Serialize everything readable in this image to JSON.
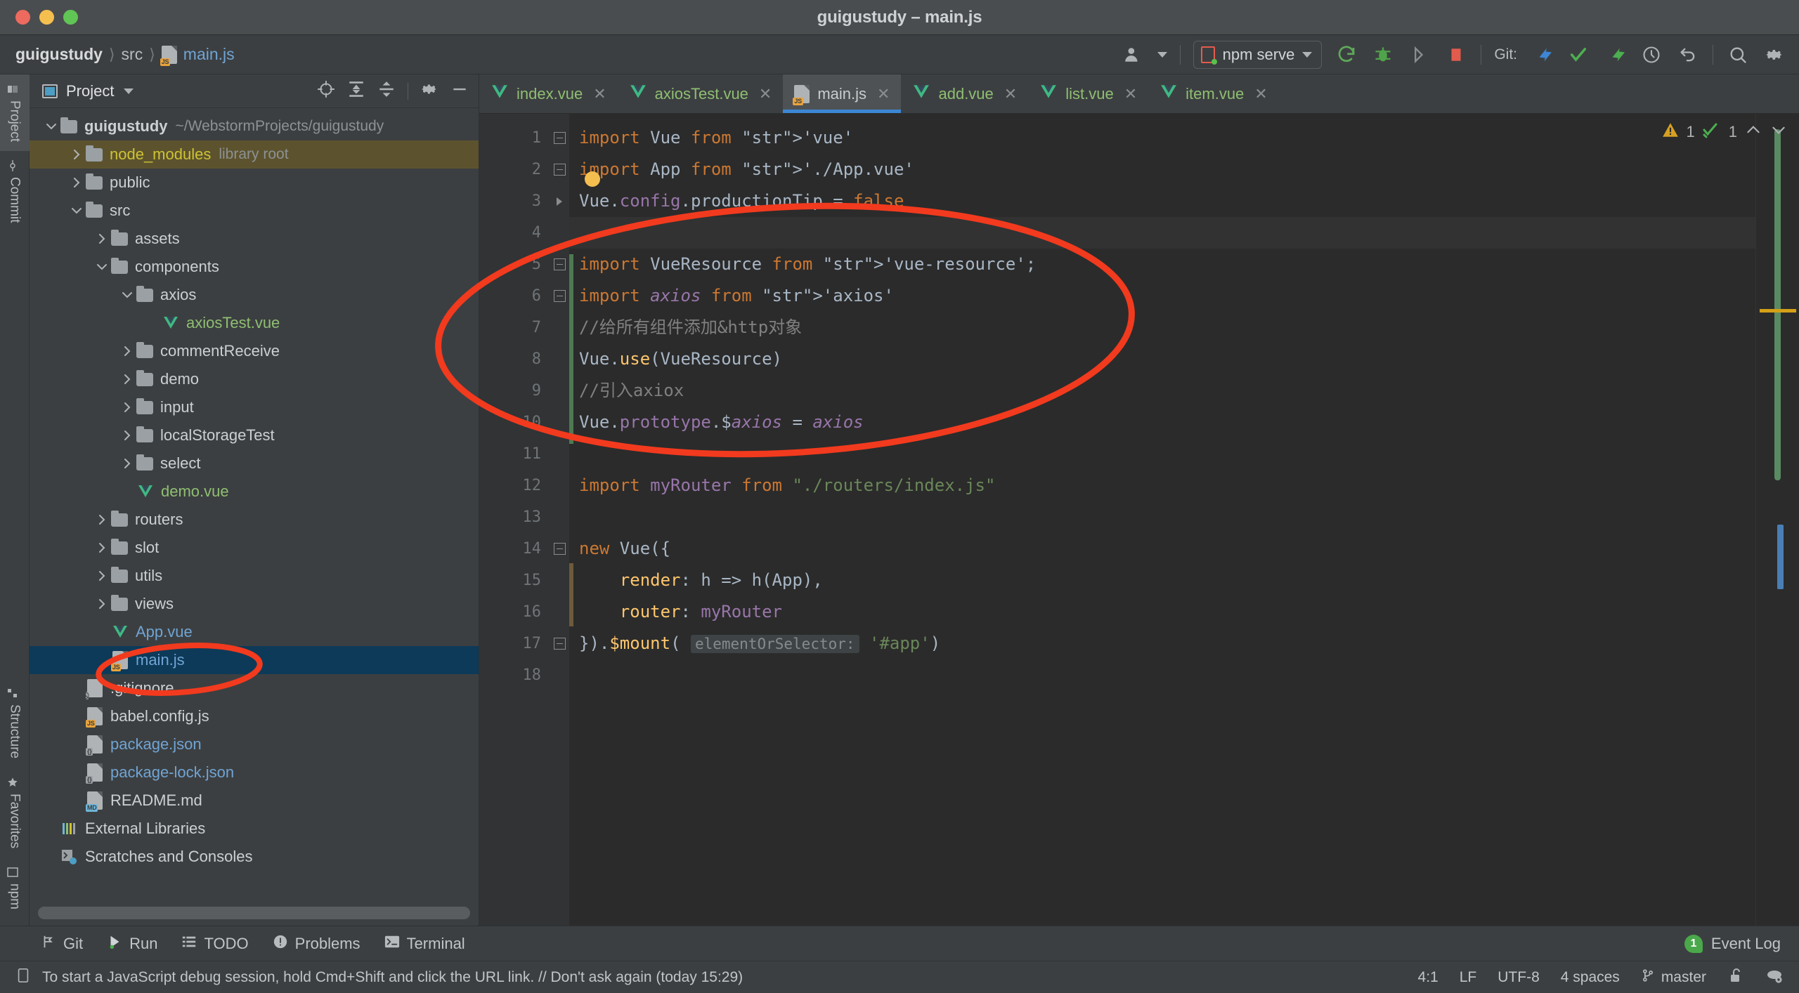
{
  "window": {
    "title": "guigustudy – main.js",
    "traffic_lights": [
      "close-red",
      "minimize-yellow",
      "zoom-green"
    ]
  },
  "breadcrumb": {
    "items": [
      {
        "label": "guigustudy",
        "kind": "project"
      },
      {
        "label": "src",
        "kind": "folder"
      },
      {
        "label": "main.js",
        "kind": "js-file"
      }
    ],
    "separator": "›"
  },
  "toolbar": {
    "account_label": "",
    "run_config": "npm serve",
    "git_label": "Git:",
    "icons": [
      "user-avatar-icon",
      "chevron-down-icon",
      "run-config-icon",
      "run-icon",
      "debug-icon",
      "coverage-icon",
      "stop-icon",
      "git-update-icon",
      "git-commit-icon",
      "git-push-icon",
      "history-icon",
      "rollback-icon",
      "search-everywhere-icon",
      "settings-gear-icon"
    ]
  },
  "left_rail": {
    "top": [
      {
        "label": "Project",
        "icon": "project-icon",
        "active": true
      },
      {
        "label": "Commit",
        "icon": "commit-icon",
        "active": false
      }
    ],
    "bottom": [
      {
        "label": "Structure",
        "icon": "structure-icon",
        "active": false
      },
      {
        "label": "Favorites",
        "icon": "star-icon",
        "active": false
      },
      {
        "label": "npm",
        "icon": "npm-icon",
        "active": false
      }
    ]
  },
  "project_panel": {
    "title": "Project",
    "toolbar_icons": [
      "locate-icon",
      "expand-all-icon",
      "collapse-all-icon",
      "settings-gear-icon",
      "hide-icon"
    ],
    "tree": [
      {
        "indent": 0,
        "arrow": "down",
        "icon": "folder",
        "label": "guigustudy",
        "sub": "~/WebstormProjects/guigustudy",
        "bold": true
      },
      {
        "indent": 1,
        "arrow": "right",
        "icon": "folder",
        "label": "node_modules",
        "sub": "library root",
        "style": "yellowish",
        "highlight": true
      },
      {
        "indent": 1,
        "arrow": "right",
        "icon": "folder",
        "label": "public"
      },
      {
        "indent": 1,
        "arrow": "down",
        "icon": "folder",
        "label": "src"
      },
      {
        "indent": 2,
        "arrow": "right",
        "icon": "folder",
        "label": "assets"
      },
      {
        "indent": 2,
        "arrow": "down",
        "icon": "folder",
        "label": "components"
      },
      {
        "indent": 3,
        "arrow": "down",
        "icon": "folder",
        "label": "axios"
      },
      {
        "indent": 4,
        "arrow": "none",
        "icon": "vue",
        "label": "axiosTest.vue",
        "style": "vue"
      },
      {
        "indent": 3,
        "arrow": "right",
        "icon": "folder",
        "label": "commentReceive"
      },
      {
        "indent": 3,
        "arrow": "right",
        "icon": "folder",
        "label": "demo"
      },
      {
        "indent": 3,
        "arrow": "right",
        "icon": "folder",
        "label": "input"
      },
      {
        "indent": 3,
        "arrow": "right",
        "icon": "folder",
        "label": "localStorageTest"
      },
      {
        "indent": 3,
        "arrow": "right",
        "icon": "folder",
        "label": "select"
      },
      {
        "indent": 3,
        "arrow": "none",
        "icon": "vue",
        "label": "demo.vue",
        "style": "vue"
      },
      {
        "indent": 2,
        "arrow": "right",
        "icon": "folder",
        "label": "routers"
      },
      {
        "indent": 2,
        "arrow": "right",
        "icon": "folder",
        "label": "slot"
      },
      {
        "indent": 2,
        "arrow": "right",
        "icon": "folder",
        "label": "utils"
      },
      {
        "indent": 2,
        "arrow": "right",
        "icon": "folder",
        "label": "views"
      },
      {
        "indent": 2,
        "arrow": "none",
        "icon": "vue",
        "label": "App.vue",
        "style": "blue"
      },
      {
        "indent": 2,
        "arrow": "none",
        "icon": "js",
        "label": "main.js",
        "style": "blue",
        "selected": true
      },
      {
        "indent": 1,
        "arrow": "none",
        "icon": "git",
        "label": ".gitignore"
      },
      {
        "indent": 1,
        "arrow": "none",
        "icon": "js",
        "label": "babel.config.js"
      },
      {
        "indent": 1,
        "arrow": "none",
        "icon": "json",
        "label": "package.json",
        "style": "json"
      },
      {
        "indent": 1,
        "arrow": "none",
        "icon": "json",
        "label": "package-lock.json",
        "style": "json"
      },
      {
        "indent": 1,
        "arrow": "none",
        "icon": "md",
        "label": "README.md"
      },
      {
        "indent": 0,
        "arrow": "none",
        "icon": "lib",
        "label": "External Libraries"
      },
      {
        "indent": 0,
        "arrow": "none",
        "icon": "scratch",
        "label": "Scratches and Consoles"
      }
    ]
  },
  "editor": {
    "tabs": [
      {
        "label": "index.vue",
        "icon": "vue-icon",
        "active": false
      },
      {
        "label": "axiosTest.vue",
        "icon": "vue-icon",
        "active": false
      },
      {
        "label": "main.js",
        "icon": "js-icon",
        "active": true
      },
      {
        "label": "add.vue",
        "icon": "vue-icon",
        "active": false
      },
      {
        "label": "list.vue",
        "icon": "vue-icon",
        "active": false
      },
      {
        "label": "item.vue",
        "icon": "vue-icon",
        "active": false
      }
    ],
    "close_glyph": "✕",
    "inspections": {
      "warning_count": "1",
      "ok_count": "1",
      "up_glyph": "⌃",
      "down_glyph": "⌄"
    },
    "line_numbers": [
      "1",
      "2",
      "3",
      "4",
      "5",
      "6",
      "7",
      "8",
      "9",
      "10",
      "11",
      "12",
      "13",
      "14",
      "15",
      "16",
      "17",
      "18"
    ],
    "lines": [
      {
        "n": 1,
        "text": "import Vue from 'vue'"
      },
      {
        "n": 2,
        "text": "import App from './App.vue'"
      },
      {
        "n": 3,
        "text": "Vue.config.productionTip = false"
      },
      {
        "n": 4,
        "text": ""
      },
      {
        "n": 5,
        "text": "import VueResource from 'vue-resource';"
      },
      {
        "n": 6,
        "text": "import axios from 'axios'"
      },
      {
        "n": 7,
        "text": "//给所有组件添加&http对象"
      },
      {
        "n": 8,
        "text": "Vue.use(VueResource)"
      },
      {
        "n": 9,
        "text": "//引入axiox"
      },
      {
        "n": 10,
        "text": "Vue.prototype.$axios = axios"
      },
      {
        "n": 11,
        "text": ""
      },
      {
        "n": 12,
        "text": "import myRouter from \"./routers/index.js\""
      },
      {
        "n": 13,
        "text": ""
      },
      {
        "n": 14,
        "text": "new Vue({"
      },
      {
        "n": 15,
        "text": "    render: h => h(App),"
      },
      {
        "n": 16,
        "text": "    router: myRouter"
      },
      {
        "n": 17,
        "text": "}).$mount( elementOrSelector: '#app')"
      },
      {
        "n": 18,
        "text": ""
      }
    ],
    "param_hint": "elementOrSelector:"
  },
  "bottom_bar": {
    "items": [
      {
        "label": "Git",
        "icon": "git-icon"
      },
      {
        "label": "Run",
        "icon": "run-icon"
      },
      {
        "label": "TODO",
        "icon": "todo-icon"
      },
      {
        "label": "Problems",
        "icon": "problems-icon"
      },
      {
        "label": "Terminal",
        "icon": "terminal-icon"
      }
    ],
    "event_log": {
      "label": "Event Log",
      "count": "1"
    }
  },
  "status_bar": {
    "message": "To start a JavaScript debug session, hold Cmd+Shift and click the URL link. // Don't ask again (today 15:29)",
    "caret": "4:1",
    "line_separator": "LF",
    "encoding": "UTF-8",
    "indent": "4 spaces",
    "branch": "master",
    "icons": [
      "lock-open-icon",
      "notifications-icon"
    ]
  },
  "annotations": {
    "accent_color": "#f23a1e",
    "shapes": [
      "ellipse-around-imports",
      "ellipse-around-main-js-in-tree"
    ]
  }
}
